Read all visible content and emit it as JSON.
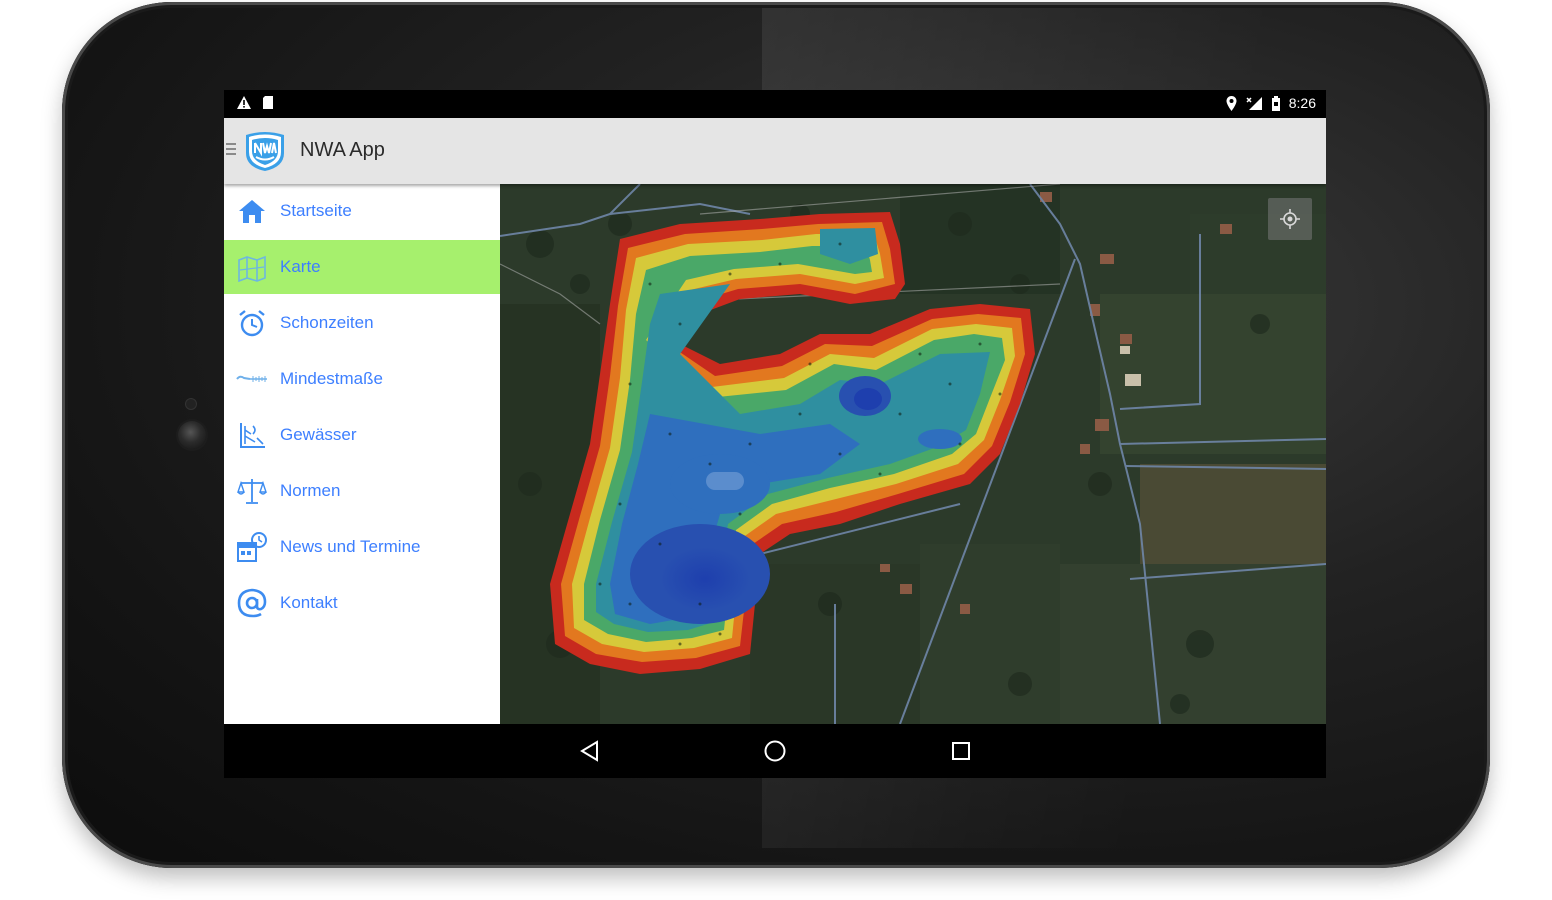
{
  "status_bar": {
    "left_icons": [
      "warning-icon",
      "sd-card-icon"
    ],
    "right_icons": [
      "location-icon",
      "signal-icon",
      "battery-icon"
    ],
    "time": "8:26"
  },
  "app_bar": {
    "title": "NWA App",
    "logo_icon": "nwa-logo-icon",
    "menu_icon": "hamburger-icon"
  },
  "drawer": {
    "selected": "Karte",
    "items": [
      {
        "label": "Startseite",
        "icon": "home-icon"
      },
      {
        "label": "Karte",
        "icon": "map-icon"
      },
      {
        "label": "Schonzeiten",
        "icon": "alarm-clock-icon"
      },
      {
        "label": "Mindestmaße",
        "icon": "ruler-icon"
      },
      {
        "label": "Gewässer",
        "icon": "water-icon"
      },
      {
        "label": "Normen",
        "icon": "scales-icon"
      },
      {
        "label": "News und Termine",
        "icon": "calendar-icon"
      },
      {
        "label": "Kontakt",
        "icon": "at-icon"
      }
    ]
  },
  "map": {
    "layer": "satellite with depth heatmap",
    "locate_button_icon": "my-location-icon"
  },
  "nav_bar": {
    "buttons": [
      "back-icon",
      "home-circle-icon",
      "recents-icon"
    ]
  },
  "colors": {
    "accent": "#3d7fff",
    "selected_bg": "#a6f06d",
    "appbar_bg": "#e5e5e5"
  }
}
